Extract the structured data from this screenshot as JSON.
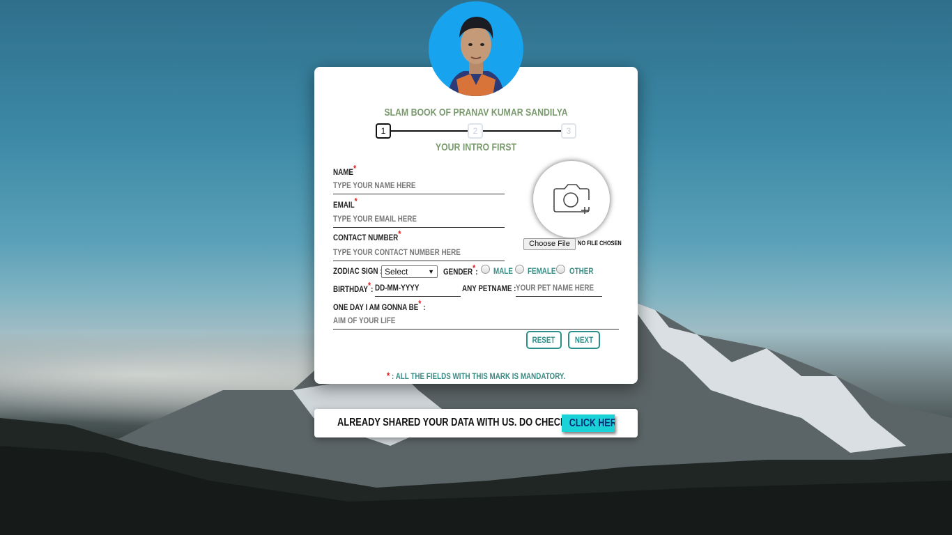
{
  "header": {
    "title": "SLAM BOOK OF PRANAV KUMAR SANDILYA",
    "subtitle": "YOUR INTRO FIRST"
  },
  "steps": [
    {
      "label": "1",
      "state": "active"
    },
    {
      "label": "2",
      "state": "inactive"
    },
    {
      "label": "3",
      "state": "inactive"
    }
  ],
  "form": {
    "name_label": "NAME",
    "name_placeholder": "TYPE YOUR NAME HERE",
    "email_label": "EMAIL",
    "email_placeholder": "TYPE YOUR EMAIL HERE",
    "contact_label": "CONTACT NUMBER",
    "contact_placeholder": "TYPE YOUR CONTACT NUMBER HERE",
    "required_mark": "*",
    "zodiac_label": "ZODIAC SIGN :",
    "zodiac_selected": "Select",
    "gender_label": "GENDER",
    "colon": ":",
    "gender_options": [
      "MALE",
      "FEMALE",
      "OTHER"
    ],
    "birthday_label": "BIRTHDAY",
    "birthday_placeholder": "DD-MM-YYYY",
    "petname_label": "ANY PETNAME :",
    "petname_placeholder": "YOUR PET NAME HERE",
    "aim_label": "ONE DAY I AM GONNA BE",
    "aim_placeholder": "AIM OF YOUR LIFE",
    "reset_label": "RESET",
    "next_label": "NEXT",
    "choose_file_label": "Choose File",
    "no_file_text": "NO FILE CHOSEN",
    "mandatory_note": ": ALL THE FIELDS WITH THIS MARK IS MANDATORY."
  },
  "footer": {
    "shared_text": "ALREADY SHARED YOUR DATA WITH US. DO CHECK IT",
    "click_here_label": "CLICK HERE"
  },
  "colors": {
    "accent_green": "#7a9a6e",
    "teal": "#2a8f8a",
    "required_red": "#e02020",
    "click_bg": "#19d3d6",
    "avatar_bg": "#18a3ee"
  },
  "icons": {
    "camera": "camera-plus-icon"
  }
}
